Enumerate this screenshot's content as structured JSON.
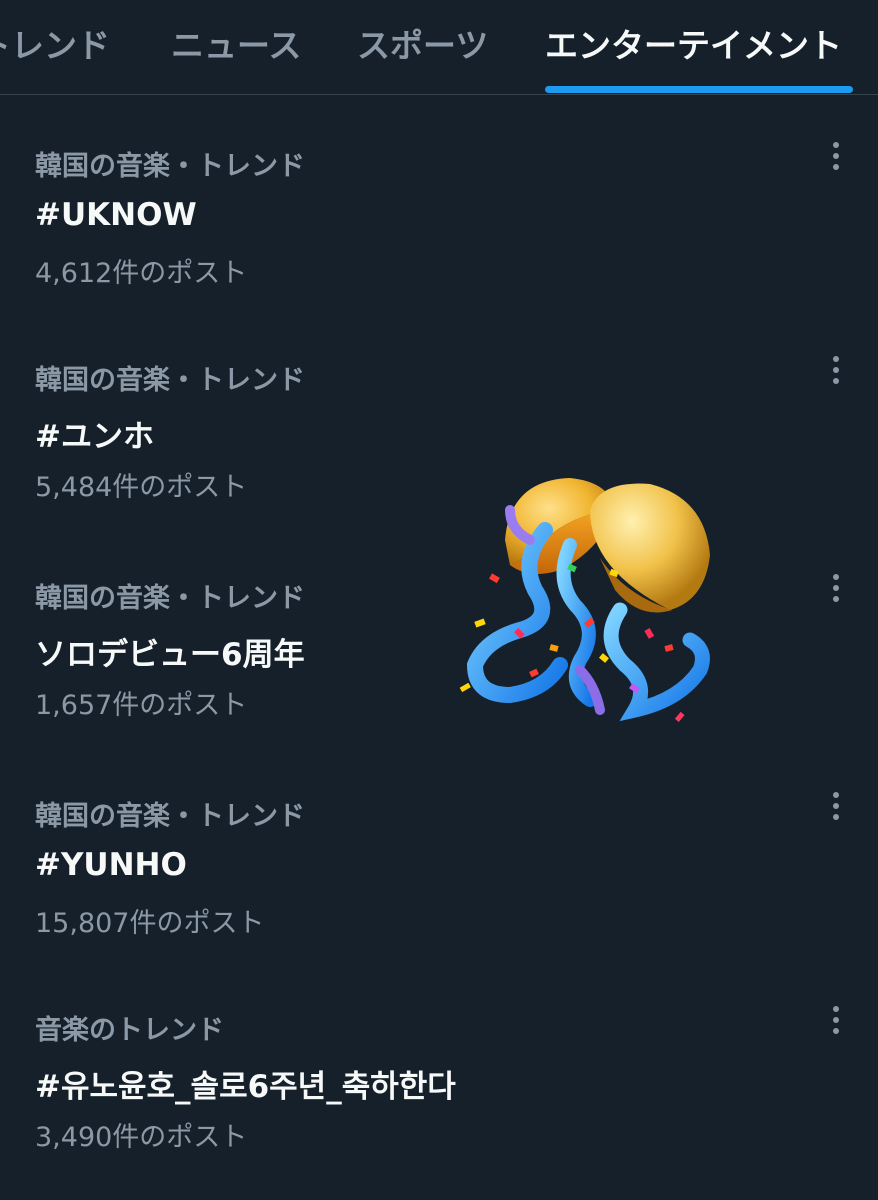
{
  "tabs": [
    {
      "label": "トレンド",
      "active": false
    },
    {
      "label": "ニュース",
      "active": false
    },
    {
      "label": "スポーツ",
      "active": false
    },
    {
      "label": "エンターテイメント",
      "active": true
    }
  ],
  "trends": [
    {
      "meta": "韓国の音楽・トレンド",
      "title": "#UKNOW",
      "count": "4,612件のポスト"
    },
    {
      "meta": "韓国の音楽・トレンド",
      "title": "#ユンホ",
      "count": "5,484件のポスト"
    },
    {
      "meta": "韓国の音楽・トレンド",
      "title": "ソロデビュー6周年",
      "count": "1,657件のポスト"
    },
    {
      "meta": "韓国の音楽・トレンド",
      "title": "#YUNHO",
      "count": "15,807件のポスト"
    },
    {
      "meta": "音楽のトレンド",
      "title": "#유노윤호_솔로6주년_축하한다",
      "count": "3,490件のポスト"
    }
  ],
  "icons": {
    "more": "more-vertical-icon",
    "sticker": "confetti-ball-icon"
  },
  "colors": {
    "background": "#15202b",
    "accent": "#1d9bf0",
    "primary_text": "#f7f9f9",
    "secondary_text": "#8b98a5",
    "divider": "#38444d"
  }
}
